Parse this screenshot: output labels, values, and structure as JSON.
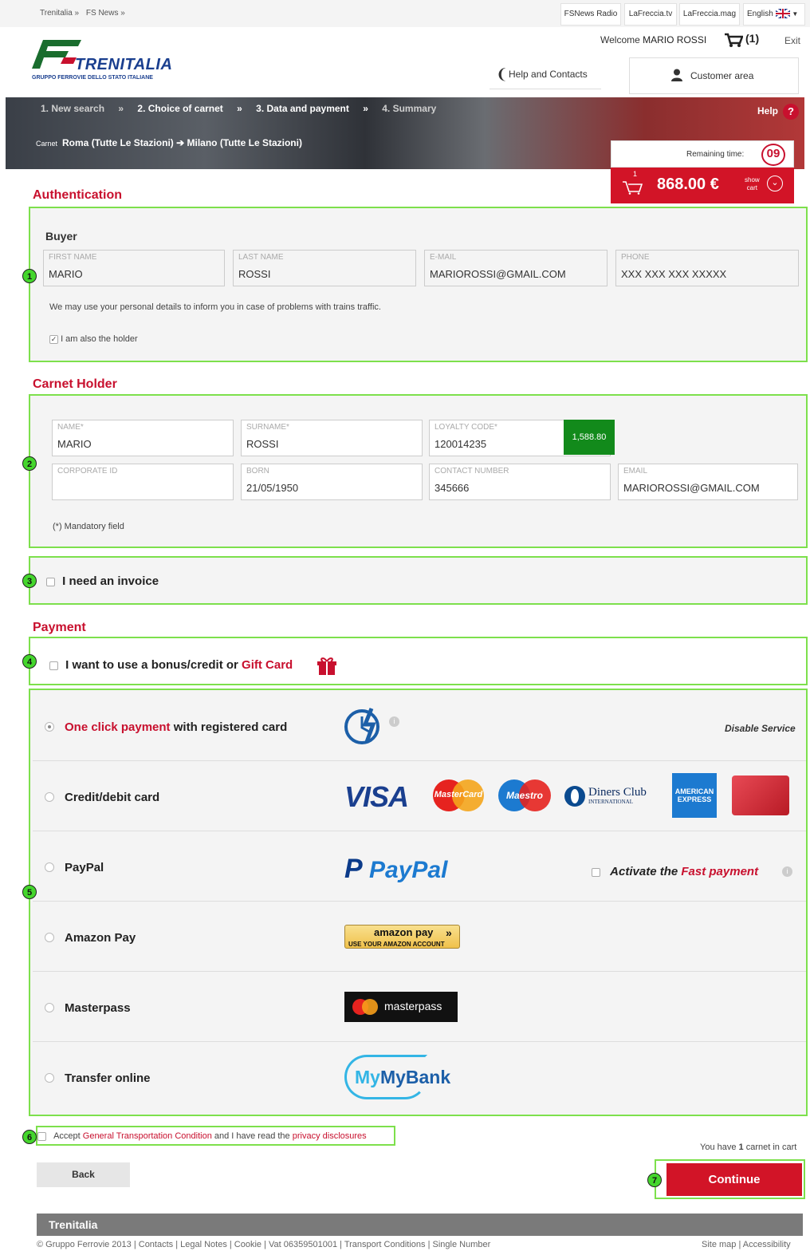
{
  "topbar": {
    "breadcrumb": [
      "Trenitalia »",
      "FS News »"
    ],
    "links": [
      "FSNews Radio",
      "LaFreccia.tv",
      "LaFreccia.mag"
    ],
    "language": "English"
  },
  "header": {
    "welcome_prefix": "Welcome",
    "user_name": "MARIO ROSSI",
    "cart_count": "(1)",
    "exit": "Exit",
    "logo_text": "TRENITALIA",
    "logo_sub": "GRUPPO FERROVIE DELLO STATO ITALIANE",
    "help_contacts": "Help and Contacts",
    "customer_area": "Customer area"
  },
  "hero": {
    "steps": [
      "1. New search",
      "»",
      "2. Choice of carnet",
      "»",
      "3. Data and payment",
      "»",
      "4. Summary"
    ],
    "help": "Help",
    "help_icon": "?",
    "route_label": "Carnet",
    "route": "Roma (Tutte Le Stazioni) ➔ Milano (Tutte Le Stazioni)"
  },
  "timer": {
    "label": "Remaining time:",
    "value": "09"
  },
  "cart": {
    "count": "1",
    "total": "868.00 €",
    "show": "show",
    "cart": "cart"
  },
  "authentication": {
    "title": "Authentication",
    "marker": "1",
    "buyer_label": "Buyer",
    "fields": [
      {
        "label": "FIRST NAME",
        "value": "MARIO"
      },
      {
        "label": "LAST NAME",
        "value": "ROSSI"
      },
      {
        "label": "E-MAIL",
        "value": "MARIOROSSI@GMAIL.COM"
      },
      {
        "label": "PHONE",
        "value": "XXX XXX XXX XXXXX"
      }
    ],
    "notice": "We may use your personal details to inform you in case of problems with trains traffic.",
    "holder_checkbox": "I am also the holder"
  },
  "holder": {
    "title": "Carnet Holder",
    "marker": "2",
    "name": {
      "label": "NAME*",
      "value": "MARIO"
    },
    "surname": {
      "label": "SURNAME*",
      "value": "ROSSI"
    },
    "loyalty": {
      "label": "LOYALTY CODE*",
      "value": "120014235",
      "points": "1,588.80"
    },
    "corporate": {
      "label": "CORPORATE ID",
      "value": ""
    },
    "born": {
      "label": "BORN",
      "value": "21/05/1950"
    },
    "contact": {
      "label": "CONTACT NUMBER",
      "value": "345666"
    },
    "email": {
      "label": "EMAIL",
      "value": "MARIOROSSI@GMAIL.COM"
    },
    "mandatory": "(*) Mandatory field"
  },
  "invoice": {
    "marker": "3",
    "label": "I need an invoice"
  },
  "payment": {
    "title": "Payment",
    "bonus_marker": "4",
    "bonus_text": "I want to use a bonus/credit or",
    "gift_card": "Gift Card",
    "methods_marker": "5",
    "methods": [
      {
        "label": "One click payment",
        "suffix": "with registered card",
        "selected": true
      },
      {
        "label": "Credit/debit card"
      },
      {
        "label": "PayPal"
      },
      {
        "label": "Amazon Pay"
      },
      {
        "label": "Masterpass"
      },
      {
        "label": "Transfer online"
      }
    ],
    "disable_service": "Disable Service",
    "activate": "Activate the",
    "fast_payment": "Fast payment",
    "logos": {
      "visa": "VISA",
      "mastercard": "MasterCard",
      "maestro": "Maestro",
      "diners": "Diners Club",
      "diners_sub": "INTERNATIONAL",
      "amex1": "AMERICAN",
      "amex2": "EXPRESS",
      "paypal": "PayPal",
      "amazon": "amazon pay",
      "amazon_sub": "USE YOUR AMAZON ACCOUNT",
      "masterpass": "masterpass",
      "mybank": "MyBank"
    }
  },
  "accept": {
    "marker": "6",
    "prefix": "Accept",
    "link1": "General Transportation Condition",
    "middle": "and I have read the",
    "link2": "privacy disclosures"
  },
  "cart_info": {
    "prefix": "You have",
    "count": "1",
    "suffix": "carnet in cart"
  },
  "buttons": {
    "back": "Back",
    "continue": "Continue",
    "continue_marker": "7"
  },
  "footer": {
    "brand": "Trenitalia",
    "links": "© Gruppo Ferrovie 2013 | Contacts | Legal Notes | Cookie | Vat 06359501001 | Transport Conditions | Single Number",
    "right": "Site map | Accessibility"
  },
  "colors": {
    "brand_red": "#c8102e",
    "highlight_green": "#7de04c",
    "loyalty_green": "#128a1b"
  }
}
